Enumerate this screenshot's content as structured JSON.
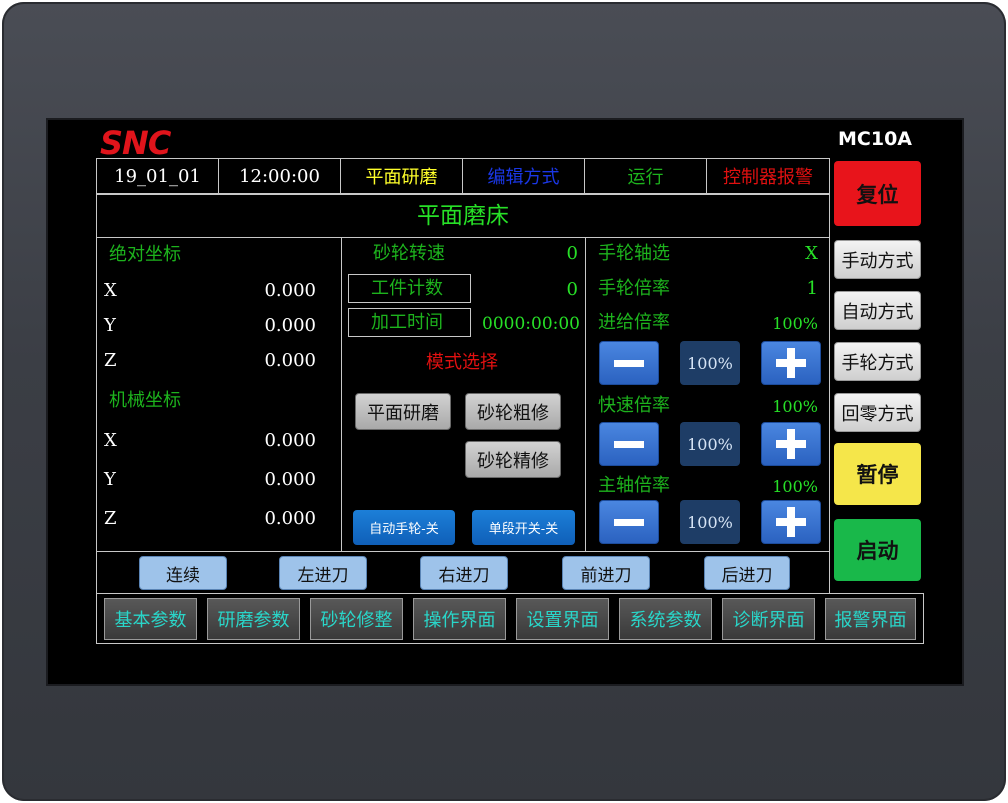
{
  "logo_text": "SNC",
  "model": "MC10A",
  "status_bar": {
    "date": "19_01_01",
    "time": "12:00:00",
    "process": "平面研磨",
    "edit_mode": "编辑方式",
    "state": "运行",
    "alarm": "控制器报警"
  },
  "title": "平面磨床",
  "coords": {
    "absolute_label": "绝对坐标",
    "machine_label": "机械坐标",
    "absolute": [
      {
        "axis": "X",
        "value": "0.000"
      },
      {
        "axis": "Y",
        "value": "0.000"
      },
      {
        "axis": "Z",
        "value": "0.000"
      }
    ],
    "machine": [
      {
        "axis": "X",
        "value": "0.000"
      },
      {
        "axis": "Y",
        "value": "0.000"
      },
      {
        "axis": "Z",
        "value": "0.000"
      }
    ]
  },
  "process_panel": {
    "wheel_speed_label": "砂轮转速",
    "wheel_speed_value": "0",
    "piece_count_label": "工件计数",
    "piece_count_value": "0",
    "machining_time_label": "加工时间",
    "machining_time_value": "0000:00:00",
    "mode_select_label": "模式选择",
    "mode_buttons": [
      "平面研磨",
      "砂轮粗修",
      "砂轮精修"
    ],
    "auto_handwheel": "自动手轮-关",
    "single_step": "单段开关-关"
  },
  "handwheel_panel": {
    "axis_select_label": "手轮轴选",
    "axis_select_value": "X",
    "ratio_label": "手轮倍率",
    "ratio_value": "1",
    "feed_label": "进给倍率",
    "feed_value": "100%",
    "feed_display": "100%",
    "rapid_label": "快速倍率",
    "rapid_value": "100%",
    "rapid_display": "100%",
    "spindle_label": "主轴倍率",
    "spindle_value": "100%",
    "spindle_display": "100%"
  },
  "side_buttons": {
    "reset": "复位",
    "manual": "手动方式",
    "auto": "自动方式",
    "handwheel": "手轮方式",
    "home": "回零方式",
    "pause": "暂停",
    "start": "启动"
  },
  "jog_buttons": [
    "连续",
    "左进刀",
    "右进刀",
    "前进刀",
    "后进刀"
  ],
  "nav_buttons": [
    "基本参数",
    "研磨参数",
    "砂轮修整",
    "操作界面",
    "设置界面",
    "系统参数",
    "诊断界面",
    "报警界面"
  ],
  "colors": {
    "reset": "#e8141b",
    "pause": "#f5e64a",
    "start": "#19b84a",
    "label_green": "#1db31d",
    "nav_text": "#29d6c9"
  }
}
